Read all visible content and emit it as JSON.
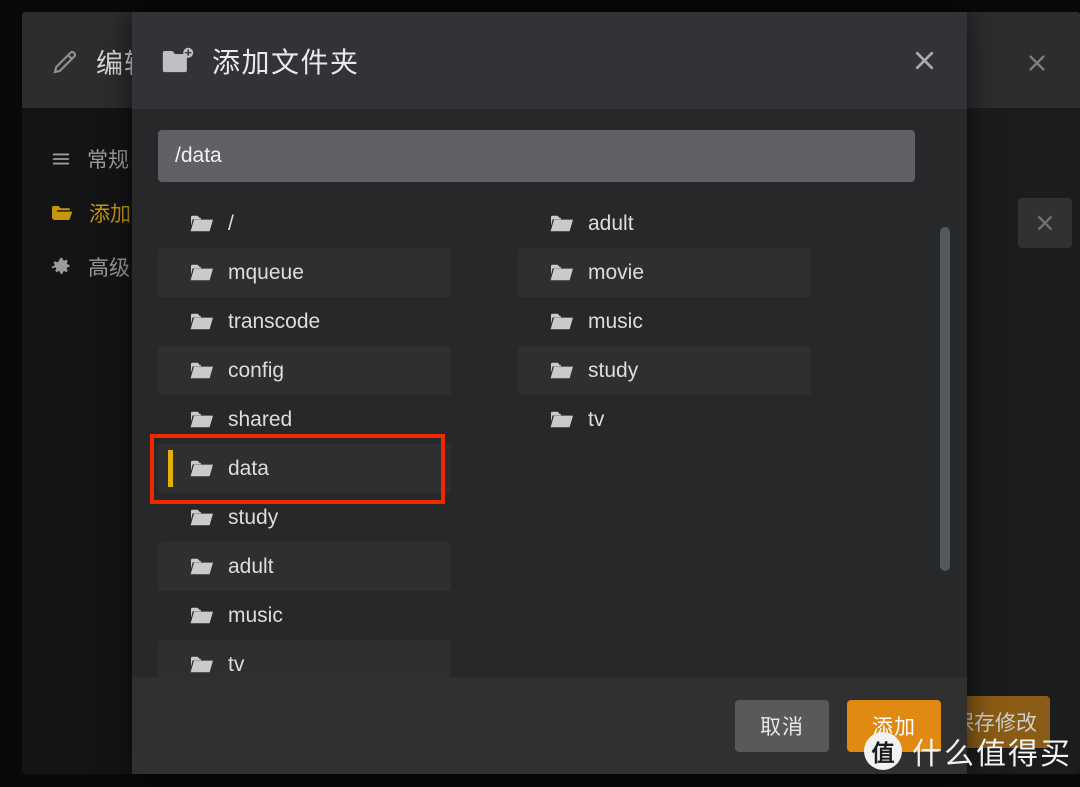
{
  "background_window": {
    "title": "编辑",
    "title_icon": "pencil-icon",
    "close_icon": "close-icon",
    "remove_icon": "close-icon",
    "nav": [
      {
        "label": "常规",
        "icon": "list-icon",
        "active": false
      },
      {
        "label": "添加文件夹",
        "icon": "folder-icon",
        "active": true
      },
      {
        "label": "高级",
        "icon": "gear-icon",
        "active": false
      }
    ],
    "save_button": "保存修改"
  },
  "dialog": {
    "title": "添加文件夹",
    "title_icon": "folder-plus-icon",
    "close_icon": "close-icon",
    "path_input": {
      "value": "/data",
      "placeholder": "/data"
    },
    "left_column": [
      {
        "name": "/",
        "icon": "folder-icon",
        "selected": false
      },
      {
        "name": "mqueue",
        "icon": "folder-icon",
        "selected": false
      },
      {
        "name": "transcode",
        "icon": "folder-icon",
        "selected": false
      },
      {
        "name": "config",
        "icon": "folder-icon",
        "selected": false
      },
      {
        "name": "shared",
        "icon": "folder-icon",
        "selected": false
      },
      {
        "name": "data",
        "icon": "folder-icon",
        "selected": true
      },
      {
        "name": "study",
        "icon": "folder-icon",
        "selected": false
      },
      {
        "name": "adult",
        "icon": "folder-icon",
        "selected": false
      },
      {
        "name": "music",
        "icon": "folder-icon",
        "selected": false
      },
      {
        "name": "tv",
        "icon": "folder-icon",
        "selected": false
      }
    ],
    "right_column": [
      {
        "name": "adult",
        "icon": "folder-icon"
      },
      {
        "name": "movie",
        "icon": "folder-icon"
      },
      {
        "name": "music",
        "icon": "folder-icon"
      },
      {
        "name": "study",
        "icon": "folder-icon"
      },
      {
        "name": "tv",
        "icon": "folder-icon"
      }
    ],
    "footer": {
      "cancel_label": "取消",
      "add_label": "添加"
    }
  },
  "annotation": {
    "shape": "rectangle",
    "color": "#f02800",
    "targets": "data"
  },
  "watermark": {
    "logo_text": "值",
    "text": "什么值得买"
  },
  "colors": {
    "dialog_header": "#313337",
    "dialog_body": "#26282a",
    "dialog_footer": "#303030",
    "input_bg": "#5f6164",
    "accent_orange": "#e08a14",
    "accent_gold": "#c8960c",
    "selection_bar": "#e2b007",
    "annotation_red": "#f02800"
  }
}
